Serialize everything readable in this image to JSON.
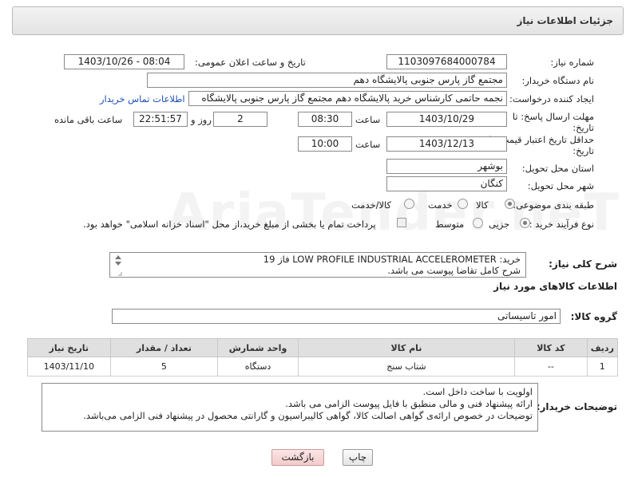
{
  "header": {
    "title": "جزئیات اطلاعات نیاز"
  },
  "fields": {
    "need_number_label": "شماره نیاز:",
    "need_number": "1103097684000784",
    "announce_label": "تاریخ و ساعت اعلان عمومی:",
    "announce_value": "1403/10/26 - 08:04",
    "buyer_org_label": "نام دستگاه خریدار:",
    "buyer_org": "مجتمع گاز پارس جنوبی  پالایشگاه دهم",
    "creator_label": "ایجاد کننده درخواست:",
    "creator": "نجمه حاتمی کارشناس خرید پالایشگاه دهم  مجتمع گاز پارس جنوبی  پالایشگاه",
    "contact_link": "اطلاعات تماس خریدار",
    "deadline_label_1": "مهلت ارسال پاسخ: تا",
    "deadline_label_2": "تاریخ:",
    "deadline_date": "1403/10/29",
    "time_label": "ساعت",
    "deadline_time": "08:30",
    "days_value": "2",
    "days_label": "روز و",
    "remaining_time": "22:51:57",
    "remaining_label": "ساعت باقی مانده",
    "validity_label_1": "حداقل تاریخ اعتبار قیمت: تا",
    "validity_label_2": "تاریخ:",
    "validity_date": "1403/12/13",
    "validity_time": "10:00",
    "province_label": "استان محل تحویل:",
    "province": "بوشهر",
    "city_label": "شهر محل تحویل:",
    "city": "کنگان",
    "category_label": "طبقه بندی موضوعی:",
    "category_options": [
      "کالا",
      "خدمت",
      "کالا/خدمت"
    ],
    "process_label": "نوع فرآیند خرید :",
    "process_options": [
      "جزیی",
      "متوسط"
    ],
    "payment_note": "پرداخت تمام یا بخشی از مبلغ خرید،از محل \"اسناد خزانه اسلامی\" خواهد بود."
  },
  "description": {
    "label": "شرح کلی نیاز:",
    "line1": "خرید:  LOW PROFILE INDUSTRIAL ACCELEROMETER فاز 19",
    "line2": "شرح کامل تقاضا پیوست می باشد."
  },
  "goods": {
    "section_title": "اطلاعات کالاهای مورد نیاز",
    "group_label": "گروه کالا:",
    "group_value": "امور تاسیساتی",
    "columns": [
      "ردیف",
      "کد کالا",
      "نام کالا",
      "واحد شمارش",
      "تعداد / مقدار",
      "تاریخ نیاز"
    ],
    "rows": [
      [
        "1",
        "--",
        "شتاب سنج",
        "دستگاه",
        "5",
        "1403/11/10"
      ]
    ]
  },
  "notes": {
    "label": "توضیحات خریدار:",
    "lines": [
      "اولویت با ساخت داخل است.",
      "ارائه پیشنهاد فنی و مالی منطبق با فایل پیوست الزامی می باشد.",
      "توضیحات در خصوص ارائه‌ی گواهی اصالت کالا، گواهی کالیبراسیون و گارانتی محصول در پیشنهاد فنی الزامی می‌باشد."
    ]
  },
  "buttons": {
    "print": "چاپ",
    "return": "بازگشت"
  },
  "watermark": "AriaTender.neT"
}
